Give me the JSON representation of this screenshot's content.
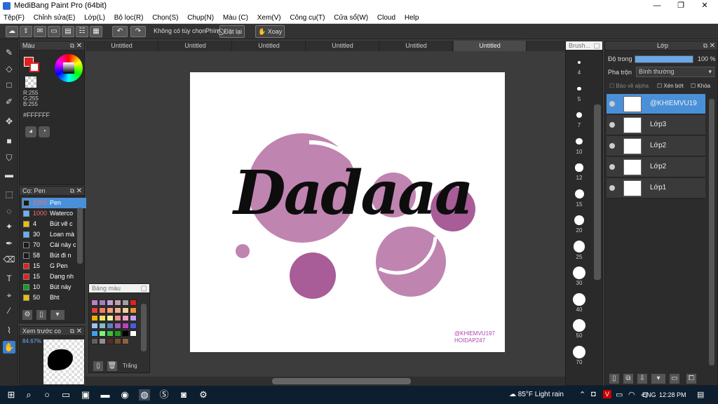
{
  "app": {
    "title": "MediBang Paint Pro (64bit)"
  },
  "window_controls": {
    "minimize": "—",
    "maximize": "❐",
    "close": "✕"
  },
  "menu": [
    "Tệp(F)",
    "Chỉnh sửa(E)",
    "Lớp(L)",
    "Bộ lọc(R)",
    "Chọn(S)",
    "Chụp(N)",
    "Màu (C)",
    "Xem(V)",
    "Công cụ(T)",
    "Cửa sổ(W)",
    "Cloud",
    "Help"
  ],
  "toolbar": {
    "no_option": "Không có tùy chọn",
    "key_label": "Phím",
    "reset_label": "Đặt lại",
    "rotate_label": "Xoay"
  },
  "tabs": [
    "Untitled",
    "Untitled",
    "Untitled",
    "Untitled",
    "Untitled",
    "Untitled"
  ],
  "color_panel": {
    "title": "Màu",
    "rgb_r": "R:255",
    "rgb_g": "G:255",
    "rgb_b": "B:255",
    "hex": "#FFFFFF"
  },
  "brush_panel": {
    "title": "Cọ: Pen",
    "items": [
      {
        "size": "1000",
        "name": "Pen",
        "color": "#1a1a1a"
      },
      {
        "size": "1000",
        "name": "Waterco",
        "color": "#66b3ff"
      },
      {
        "size": "4",
        "name": "Bút vẽ c",
        "color": "#e8c000"
      },
      {
        "size": "30",
        "name": "Loan mà",
        "color": "#5ab4ff"
      },
      {
        "size": "70",
        "name": "Cái này c",
        "color": "#1a1a1a"
      },
      {
        "size": "58",
        "name": "Bút đi n",
        "color": "#1a1a1a"
      },
      {
        "size": "15",
        "name": "G Pen",
        "color": "#e02020"
      },
      {
        "size": "15",
        "name": "Dạng nh",
        "color": "#e02020"
      },
      {
        "size": "10",
        "name": "Bút này",
        "color": "#10a020"
      },
      {
        "size": "50",
        "name": "Bht",
        "color": "#e8c000"
      }
    ]
  },
  "navigator": {
    "title": "Xem trước co",
    "zoom": "84.67%"
  },
  "palette_panel": {
    "title": "Bảng màu",
    "footer_label": "Trắng"
  },
  "canvas": {
    "title_text": "Dadaaa",
    "watermark_line1": "@KHIEMVU197",
    "watermark_line2": "HOIDAP247"
  },
  "brush_sizes_panel": {
    "title": "Brush...",
    "sizes": [
      "4",
      "5",
      "7",
      "10",
      "12",
      "15",
      "20",
      "25",
      "30",
      "40",
      "50",
      "70"
    ]
  },
  "layer_panel": {
    "title": "Lớp",
    "opacity_label": "Độ trong",
    "opacity_value": "100 %",
    "opacity_level": 1.0,
    "blend_label": "Pha trộn",
    "blend_value": "Bình thường",
    "protect_alpha": "Bảo vệ alpha",
    "clipping": "Xén bớt",
    "lock": "Khóa",
    "layers": [
      {
        "name": "@KHIEMVU19",
        "selected": true
      },
      {
        "name": "Lớp3",
        "selected": false
      },
      {
        "name": "Lớp2",
        "selected": false
      },
      {
        "name": "Lớp2",
        "selected": false
      },
      {
        "name": "Lớp1",
        "selected": false
      }
    ]
  },
  "taskbar": {
    "weather": "85°F  Light rain",
    "lang": "ENG",
    "time": "12:28 PM"
  },
  "colors": {
    "accent": "#4a90d9",
    "canvas_circle": "#c084b0",
    "canvas_circle_dark": "#a85c98"
  }
}
